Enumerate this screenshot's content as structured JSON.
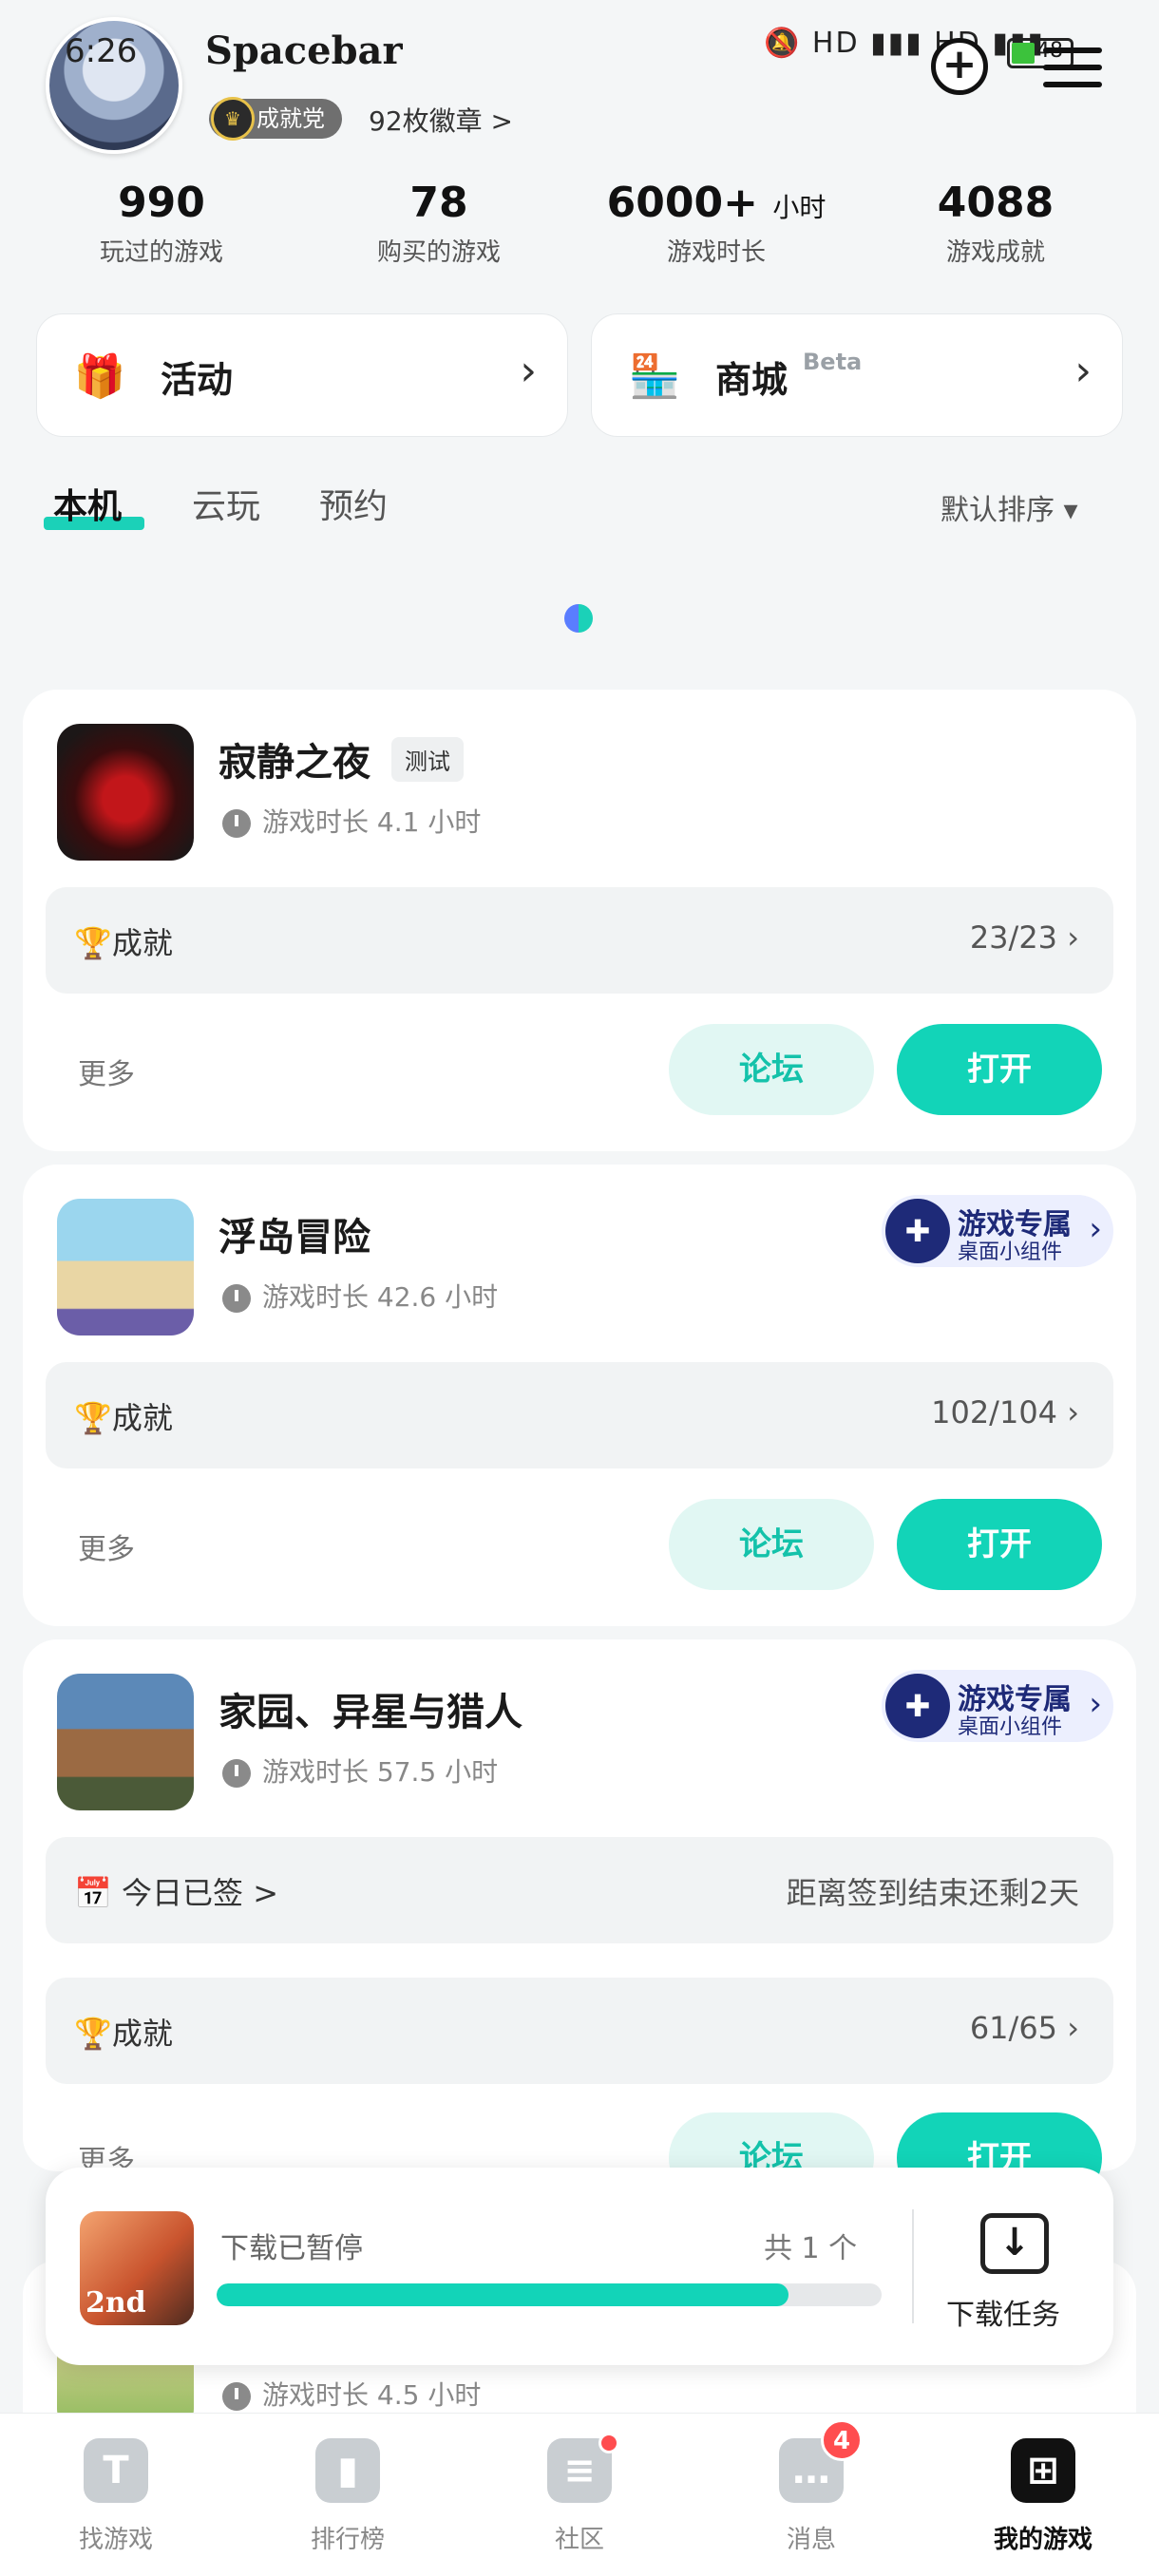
{
  "status_bar": {
    "time": "6:26",
    "signal": "HD ▮▮▮ HD ▮▮▮",
    "battery": "48"
  },
  "profile": {
    "username": "Spacebar",
    "title_badge": "成就党",
    "badges_link": "92枚徽章 >"
  },
  "stats": [
    {
      "value": "990",
      "unit": "",
      "label": "玩过的游戏"
    },
    {
      "value": "78",
      "unit": "",
      "label": "购买的游戏"
    },
    {
      "value": "6000+",
      "unit": "小时",
      "label": "游戏时长"
    },
    {
      "value": "4088",
      "unit": "",
      "label": "游戏成就"
    }
  ],
  "cards": {
    "activity": {
      "label": "活动"
    },
    "store": {
      "label": "商城",
      "beta": "Beta"
    }
  },
  "tabs": [
    "本机",
    "云玩",
    "预约"
  ],
  "sort_label": "默认排序 ▾",
  "games": [
    {
      "title": "寂静之夜",
      "tag": "测试",
      "playtime": "游戏时长 4.1 小时",
      "achievement_label": "成就",
      "achievement_progress": "23/23",
      "more": "更多",
      "forum": "论坛",
      "open": "打开"
    },
    {
      "title": "浮岛冒险",
      "widget_title": "游戏专属",
      "widget_sub": "桌面小组件",
      "playtime": "游戏时长 42.6 小时",
      "achievement_label": "成就",
      "achievement_progress": "102/104",
      "more": "更多",
      "forum": "论坛",
      "open": "打开"
    },
    {
      "title": "家园、异星与猎人",
      "widget_title": "游戏专属",
      "widget_sub": "桌面小组件",
      "playtime": "游戏时长 57.5 小时",
      "checkin_label": "今日已签 >",
      "checkin_remaining": "距离签到结束还剩2天",
      "achievement_label": "成就",
      "achievement_progress": "61/65",
      "more": "更多",
      "forum": "论坛",
      "open": "打开"
    },
    {
      "playtime": "游戏时长 4.5 小时"
    }
  ],
  "download": {
    "status": "下载已暂停",
    "count": "共 1 个",
    "progress": 0.86,
    "task_label": "下载任务",
    "icon_text": "2nd"
  },
  "bottom_nav": [
    {
      "label": "找游戏",
      "icon": "T"
    },
    {
      "label": "排行榜",
      "icon": "▮"
    },
    {
      "label": "社区",
      "icon": "≡"
    },
    {
      "label": "消息",
      "icon": "…",
      "badge": "4"
    },
    {
      "label": "我的游戏",
      "icon": "⊞"
    }
  ],
  "colors": {
    "accent": "#12d4b8",
    "forum_bg": "#e1f7f3",
    "badge_red": "#ff4d4f"
  }
}
